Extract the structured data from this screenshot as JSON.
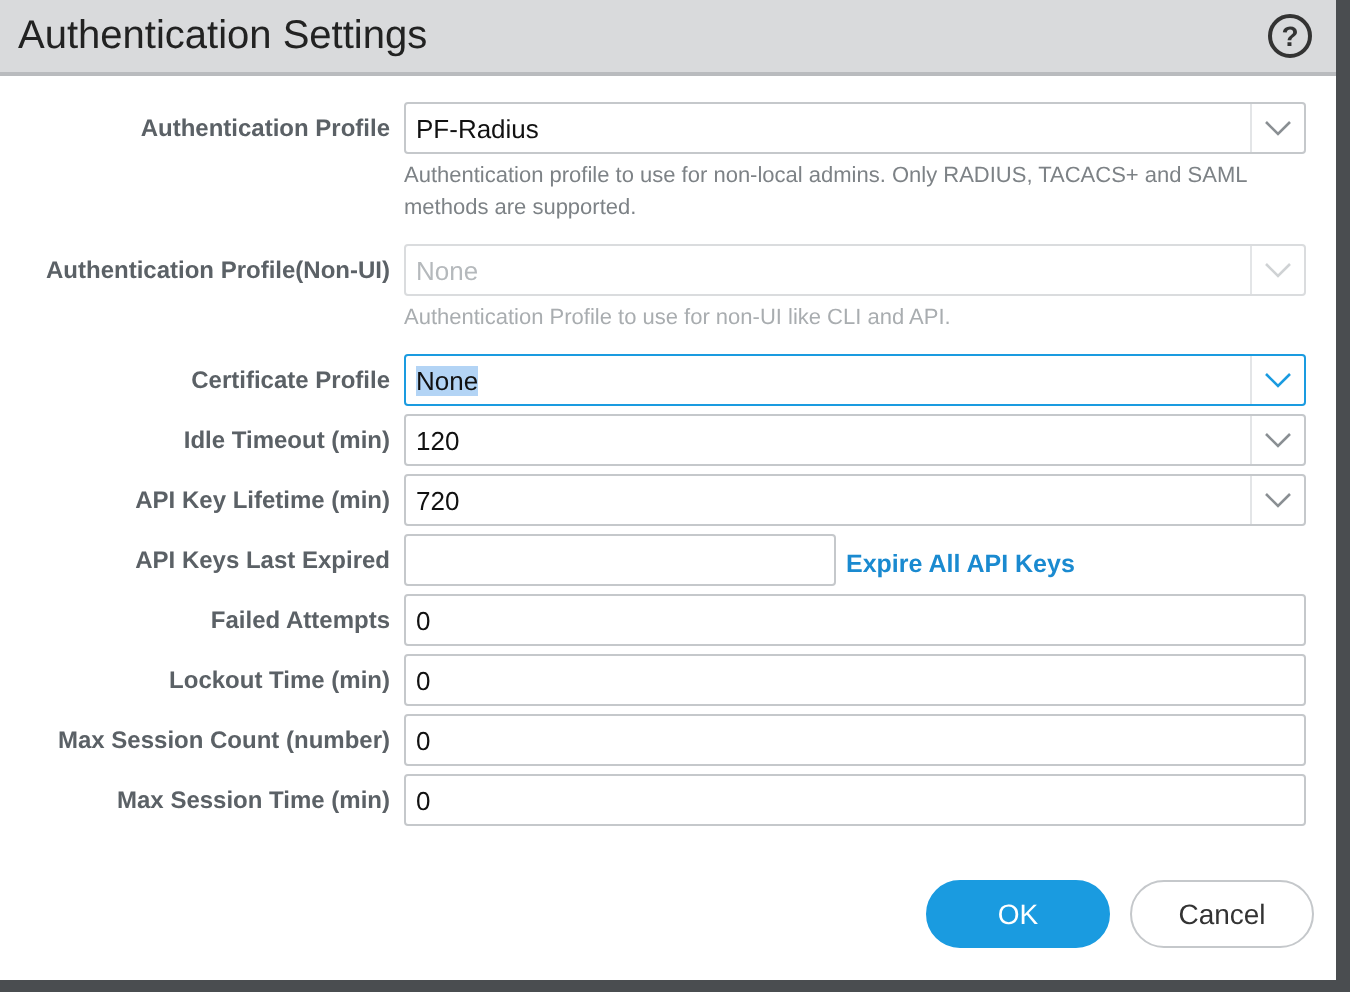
{
  "dialog": {
    "title": "Authentication Settings",
    "help_icon": "?"
  },
  "fields": [
    {
      "label": "Authentication Profile",
      "kind": "select",
      "value": "PF-Radius",
      "hint": "Authentication profile to use for non-local admins. Only RADIUS, TACACS+ and SAML methods are supported."
    },
    {
      "label": "Authentication Profile(Non-UI)",
      "kind": "select",
      "placeholder": "None",
      "disabled": true,
      "hint": "Authentication Profile to use for non-UI like CLI and API."
    },
    {
      "label": "Certificate Profile",
      "kind": "select",
      "value": "None",
      "focused": true,
      "value_selected": true
    },
    {
      "label": "Idle Timeout (min)",
      "kind": "select",
      "value": "120"
    },
    {
      "label": "API Key Lifetime (min)",
      "kind": "select",
      "value": "720"
    },
    {
      "label": "API Keys Last Expired",
      "kind": "text-link",
      "link": "Expire All API Keys"
    },
    {
      "label": "Failed Attempts",
      "kind": "text",
      "value": "0"
    },
    {
      "label": "Lockout Time (min)",
      "kind": "text",
      "value": "0"
    },
    {
      "label": "Max Session Count (number)",
      "kind": "text",
      "value": "0"
    },
    {
      "label": "Max Session Time (min)",
      "kind": "text",
      "value": "0"
    }
  ],
  "buttons": [
    {
      "label": "OK",
      "kind": "primary"
    },
    {
      "label": "Cancel",
      "kind": "secondary"
    }
  ]
}
